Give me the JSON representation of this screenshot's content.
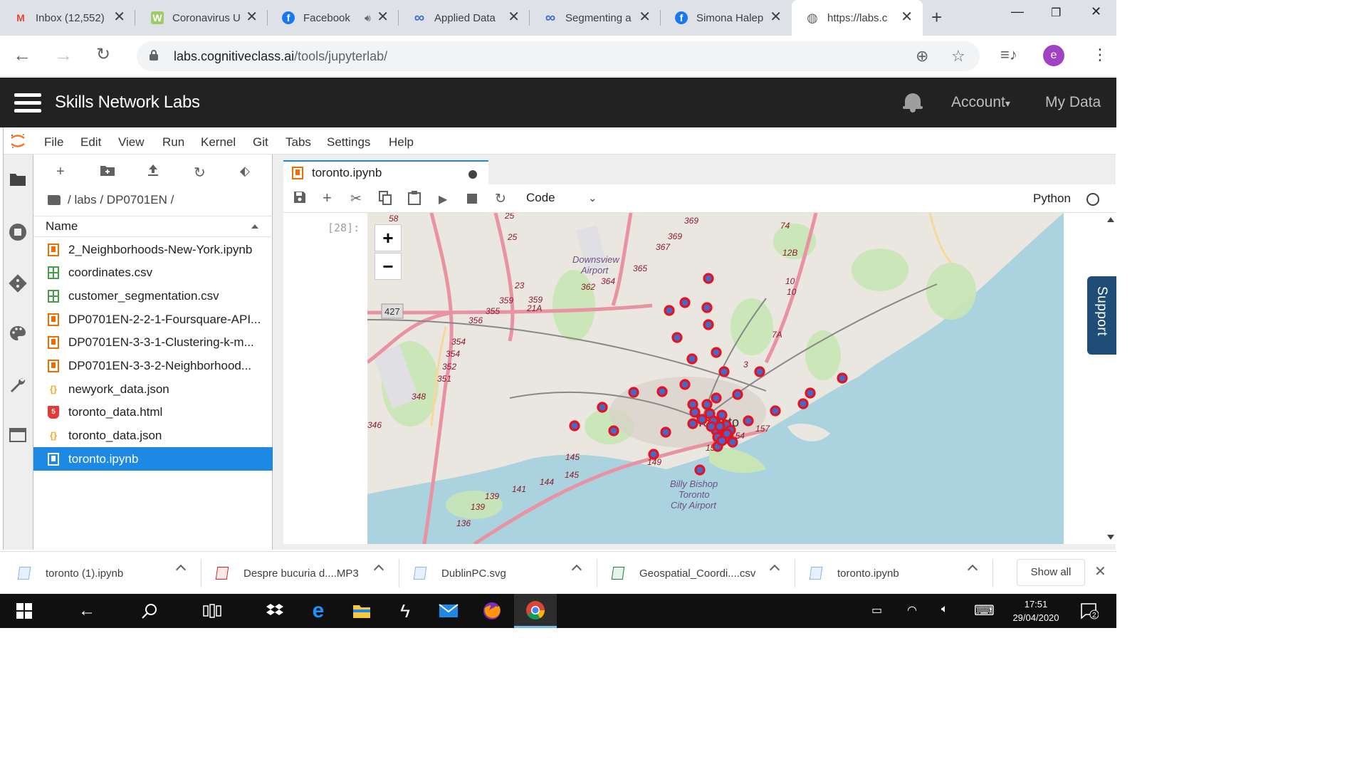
{
  "browser": {
    "tabs": [
      {
        "title": "Inbox (12,552)",
        "icon": "gmail-icon",
        "favicon_text": "M",
        "color": "#ea4335"
      },
      {
        "title": "Coronavirus U",
        "icon": "worldometer-icon",
        "favicon_text": "W",
        "color": "#9ccc65"
      },
      {
        "title": "Facebook",
        "icon": "facebook-icon",
        "favicon_text": "f",
        "color": "#1877f2"
      },
      {
        "title": "Applied Data",
        "icon": "coursera-icon",
        "favicon_text": "∞",
        "color": "#3b6bd9"
      },
      {
        "title": "Segmenting a",
        "icon": "coursera-icon",
        "favicon_text": "∞",
        "color": "#3b6bd9"
      },
      {
        "title": "Simona Halep",
        "icon": "facebook-icon",
        "favicon_text": "f",
        "color": "#1877f2"
      },
      {
        "title": "https://labs.c",
        "icon": "globe-icon",
        "favicon_text": "◍",
        "color": "#5f6368"
      }
    ],
    "url_host": "labs.cognitiveclass.ai",
    "url_path": "/tools/jupyterlab/",
    "avatar_letter": "e"
  },
  "header": {
    "title": "Skills Network Labs",
    "account": "Account",
    "account_caret": "▾",
    "my_data": "My Data"
  },
  "jupyter": {
    "menus": [
      "File",
      "Edit",
      "View",
      "Run",
      "Kernel",
      "Git",
      "Tabs",
      "Settings",
      "Help"
    ],
    "breadcrumb": "/ labs / DP0701EN /",
    "list_header": "Name",
    "files": [
      {
        "name": "2_Neighborhoods-New-York.ipynb",
        "type": "nb"
      },
      {
        "name": "coordinates.csv",
        "type": "csv"
      },
      {
        "name": "customer_segmentation.csv",
        "type": "csv"
      },
      {
        "name": "DP0701EN-2-2-1-Foursquare-API...",
        "type": "nb"
      },
      {
        "name": "DP0701EN-3-3-1-Clustering-k-m...",
        "type": "nb"
      },
      {
        "name": "DP0701EN-3-3-2-Neighborhood...",
        "type": "nb"
      },
      {
        "name": "newyork_data.json",
        "type": "json"
      },
      {
        "name": "toronto_data.html",
        "type": "html"
      },
      {
        "name": "toronto_data.json",
        "type": "json"
      },
      {
        "name": "toronto.ipynb",
        "type": "nb",
        "selected": true
      }
    ],
    "doc_tab": "toronto.ipynb",
    "cell_type": "Code",
    "kernel": "Python",
    "prompt": "[28]:",
    "zoom_in": "+",
    "zoom_out": "−",
    "support": "Support"
  },
  "map": {
    "labels": {
      "airport_downsview": "Downsview Airport",
      "airport_billy": "Billy Bishop Toronto City Airport",
      "city": "Toronto"
    },
    "markers_count": 47,
    "marker_color": "#e8111e",
    "marker_fill": "#3f6bd1"
  },
  "downloads": [
    {
      "name": "toronto (1).ipynb"
    },
    {
      "name": "Despre bucuria d....MP3"
    },
    {
      "name": "DublinPC.svg"
    },
    {
      "name": "Geospatial_Coordi....csv"
    },
    {
      "name": "toronto.ipynb"
    }
  ],
  "shelf": {
    "show_all": "Show all"
  },
  "taskbar": {
    "time": "17:51",
    "date": "29/04/2020",
    "notifications": "2"
  }
}
